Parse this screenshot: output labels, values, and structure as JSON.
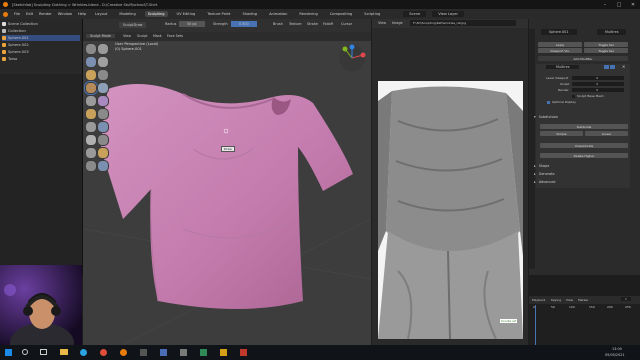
{
  "window": {
    "title": "[Sketchfab] Sculpting Clothing > Wrinkles.blend - D:\\Creative Stuff\\school\\T-Shirt",
    "minimize": "–",
    "maximize": "□",
    "close": "✕"
  },
  "menubar": {
    "items": [
      "File",
      "Edit",
      "Render",
      "Window",
      "Help"
    ],
    "workspace_tabs": [
      "Layout",
      "Modeling",
      "Sculpting",
      "UV Editing",
      "Texture Paint",
      "Shading",
      "Animation",
      "Rendering",
      "Compositing",
      "Scripting"
    ],
    "active_tab": "Sculpting",
    "scene_label": "Scene",
    "view_layer_label": "View Layer"
  },
  "outliner": {
    "title": "Scene Collection",
    "rows": [
      {
        "label": "Scene Collection",
        "selected": false
      },
      {
        "label": "Collection",
        "selected": false
      },
      {
        "label": "Sphere.001",
        "selected": true
      },
      {
        "label": "Sphere.002",
        "selected": false
      },
      {
        "label": "Sphere.003",
        "selected": false
      },
      {
        "label": "Torso",
        "selected": false
      }
    ]
  },
  "viewport": {
    "mode": "Sculpt Mode",
    "menus": [
      "View",
      "Sculpt",
      "Mask",
      "Face Sets"
    ],
    "info_line1": "User Perspective (Local)",
    "info_line2": "(0) Sphere.001",
    "tooltip": "Draw",
    "brush_name": "SculptDraw",
    "radius_label": "Radius",
    "radius_value": "50 px",
    "strength_label": "Strength",
    "strength_value": "0.500",
    "tool_menus": [
      "Brush",
      "Texture",
      "Stroke",
      "Falloff",
      "Cursor"
    ]
  },
  "reference": {
    "path": "F:\\3D\\Sculpting\\Ref\\wrinkles_ref.jpg",
    "menus": [
      "View",
      "Image"
    ],
    "watermark": "hoodie ref"
  },
  "properties": {
    "object_name": "Sphere.001",
    "modifier_name": "Multires",
    "add_modifier": "Add Modifier",
    "apply": "Apply",
    "viewport_vis": "Viewport Vis.",
    "toggle_sel": "Toggle Sel",
    "level_viewport_label": "Level Viewport",
    "level_viewport": "4",
    "sculpt_label": "Sculpt",
    "sculpt_level": "4",
    "render_label": "Render",
    "render_level": "4",
    "sculpt_base_mesh": "Sculpt Base Mesh",
    "optimal_display": "Optimal Display",
    "subdivision_label": "Subdivision",
    "subdivide": "Subdivide",
    "simple": "Simple",
    "linear": "Linear",
    "unsubdivide": "Unsubdivide",
    "delete_higher": "Delete Higher",
    "shape_label": "Shape",
    "generate_label": "Generate",
    "advanced_label": "Advanced"
  },
  "timeline": {
    "menus": [
      "Playback",
      "Keying",
      "View",
      "Marker"
    ],
    "frame": "1",
    "ticks": [
      "0",
      "50",
      "100",
      "150",
      "200",
      "250"
    ]
  },
  "taskbar": {
    "time": "13:04",
    "date": "09/05/2021"
  },
  "colors": {
    "shirt": "#c97fb2",
    "accent_blue": "#4772b3",
    "viewport_bg": "#3d3d3d",
    "panel_bg": "#2b2b2b"
  }
}
